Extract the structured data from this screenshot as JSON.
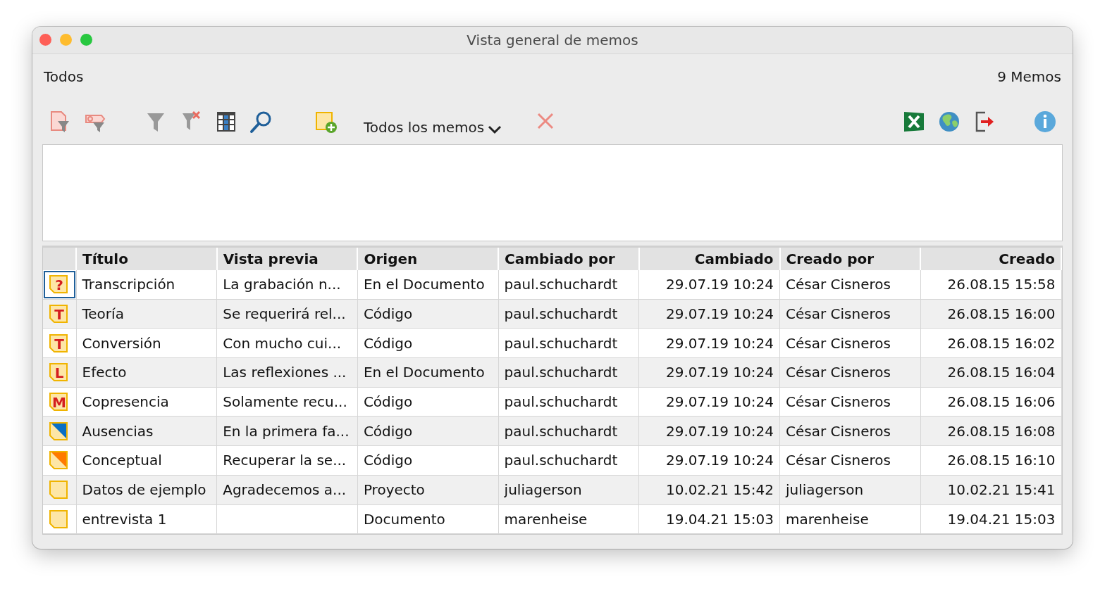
{
  "window": {
    "title": "Vista general de memos"
  },
  "header": {
    "filter_label": "Todos",
    "count": "9 Memos"
  },
  "toolbar": {
    "dropdown": "Todos los memos"
  },
  "table": {
    "columns": [
      {
        "label": "Título",
        "kind": "text"
      },
      {
        "label": "Vista previa",
        "kind": "text"
      },
      {
        "label": "Origen",
        "kind": "text"
      },
      {
        "label": "Cambiado por",
        "kind": "text"
      },
      {
        "label": "Cambiado",
        "kind": "date"
      },
      {
        "label": "Creado por",
        "kind": "text"
      },
      {
        "label": "Creado",
        "kind": "date"
      }
    ],
    "rows": [
      {
        "icon": {
          "kind": "letter",
          "symbol": "?"
        },
        "focused": true,
        "cells": [
          "Transcripción",
          "La grabación n...",
          "En el Documento",
          "paul.schuchardt",
          "29.07.19 10:24",
          "César Cisneros",
          "26.08.15 15:58"
        ]
      },
      {
        "icon": {
          "kind": "letter",
          "symbol": "T"
        },
        "focused": false,
        "cells": [
          "Teoría",
          "Se requerirá rel...",
          "Código",
          "paul.schuchardt",
          "29.07.19 10:24",
          "César Cisneros",
          "26.08.15 16:00"
        ]
      },
      {
        "icon": {
          "kind": "letter",
          "symbol": "T"
        },
        "focused": false,
        "cells": [
          "Conversión",
          "Con mucho cui...",
          "Código",
          "paul.schuchardt",
          "29.07.19 10:24",
          "César Cisneros",
          "26.08.15 16:02"
        ]
      },
      {
        "icon": {
          "kind": "letter",
          "symbol": "L"
        },
        "focused": false,
        "cells": [
          "Efecto",
          "Las reflexiones ...",
          "En el Documento",
          "paul.schuchardt",
          "29.07.19 10:24",
          "César Cisneros",
          "26.08.15 16:04"
        ]
      },
      {
        "icon": {
          "kind": "letter",
          "symbol": "M"
        },
        "focused": false,
        "cells": [
          "Copresencia",
          "Solamente recu...",
          "Código",
          "paul.schuchardt",
          "29.07.19 10:24",
          "César Cisneros",
          "26.08.15 16:06"
        ]
      },
      {
        "icon": {
          "kind": "corner",
          "color": "#0a6fc4"
        },
        "focused": false,
        "cells": [
          "Ausencias",
          "En la primera fa...",
          "Código",
          "paul.schuchardt",
          "29.07.19 10:24",
          "César Cisneros",
          "26.08.15 16:08"
        ]
      },
      {
        "icon": {
          "kind": "corner",
          "color": "#ff7a00"
        },
        "focused": false,
        "cells": [
          "Conceptual",
          "Recuperar la se...",
          "Código",
          "paul.schuchardt",
          "29.07.19 10:24",
          "César Cisneros",
          "26.08.15 16:10"
        ]
      },
      {
        "icon": {
          "kind": "plain"
        },
        "focused": false,
        "cells": [
          "Datos de ejemplo",
          "Agradecemos a...",
          "Proyecto",
          "juliagerson",
          "10.02.21 15:42",
          "juliagerson",
          "10.02.21 15:41"
        ]
      },
      {
        "icon": {
          "kind": "plain"
        },
        "focused": false,
        "cells": [
          "entrevista 1",
          "",
          "Documento",
          "marenheise",
          "19.04.21 15:03",
          "marenheise",
          "19.04.21 15:03"
        ]
      }
    ]
  }
}
